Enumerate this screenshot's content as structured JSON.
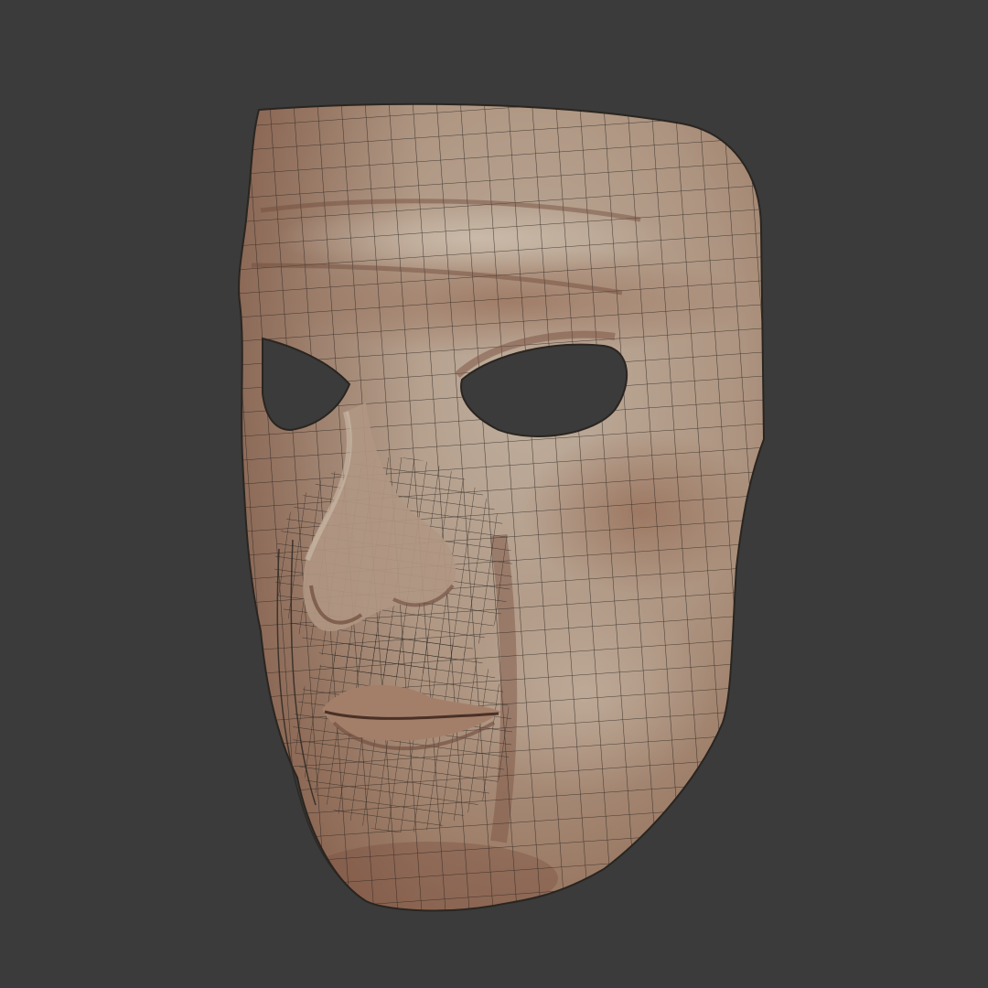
{
  "scene": {
    "background_color": "#3b3b3b",
    "subject": "mask-3d-wireframe-render",
    "colors": {
      "skin_light": "#b8a796",
      "skin_mid": "#a48a74",
      "skin_shadow": "#8a6048",
      "wire": "#2a2520",
      "hole": "#3b3b3b"
    }
  }
}
